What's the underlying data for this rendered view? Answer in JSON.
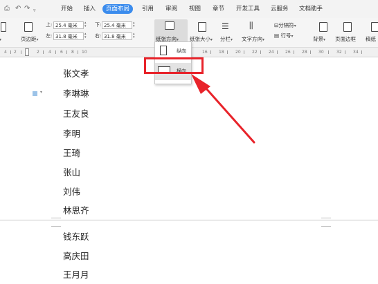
{
  "menu": {
    "tabs": [
      "开始",
      "插入",
      "页面布局",
      "引用",
      "审阅",
      "视图",
      "章节",
      "开发工具",
      "云服务",
      "文档助手"
    ],
    "active_tab": "页面布局"
  },
  "ribbon": {
    "margins_label": "页边距",
    "top_label": "上:",
    "top_value": "25.4 毫米",
    "bottom_label": "下:",
    "bottom_value": "25.4 毫米",
    "left_label": "左:",
    "left_value": "31.8 毫米",
    "right_label": "右:",
    "right_value": "31.8 毫米",
    "orientation_label": "纸张方向",
    "size_label": "纸张大小",
    "columns_label": "分栏",
    "text_direction_label": "文字方向",
    "breaks_label": "分隔符",
    "line_numbers_label": "行号",
    "background_label": "背景",
    "page_border_label": "页面边框",
    "manuscript_label": "稿纸"
  },
  "ruler": {
    "numbers": [
      "4",
      "2",
      "2",
      "4",
      "6",
      "8",
      "10",
      "16",
      "18",
      "20",
      "22",
      "24",
      "26",
      "28",
      "30",
      "32",
      "34"
    ]
  },
  "orientation_menu": {
    "portrait_label": "纵向",
    "landscape_label": "横向"
  },
  "document": {
    "names_page1": [
      "张文孝",
      "李琳琳",
      "王友良",
      "李明",
      "王琦",
      "张山",
      "刘伟",
      "林思齐"
    ],
    "names_page2": [
      "钱东跃",
      "高庆田",
      "王月月"
    ]
  },
  "colors": {
    "accent": "#3b8ced",
    "highlight": "#e8232a",
    "arrow": "#e8232a"
  }
}
